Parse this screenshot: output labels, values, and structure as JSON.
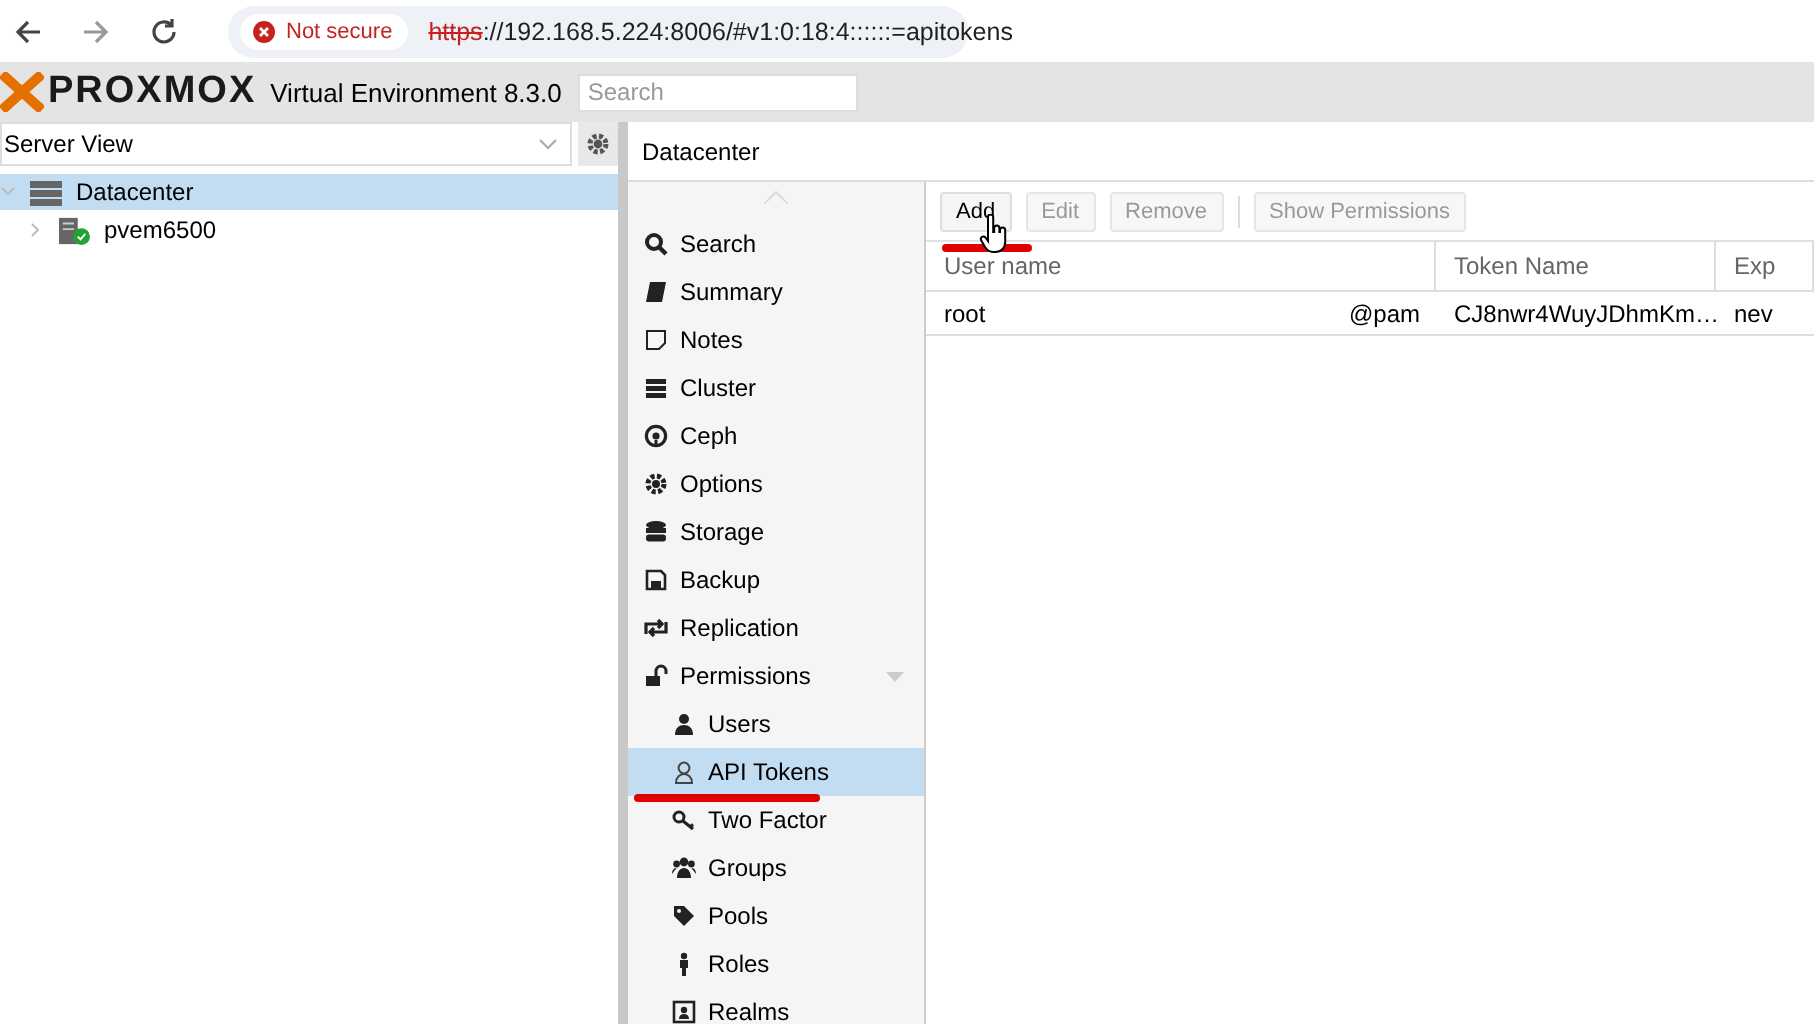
{
  "browser": {
    "security": "Not secure",
    "url_scheme": "https",
    "url_rest": "://192.168.5.224:8006/#v1:0:18:4::::::=apitokens"
  },
  "header": {
    "logo": "PROXMOX",
    "product": "Virtual Environment 8.3.0",
    "search": {
      "placeholder": "Search"
    }
  },
  "sidebar": {
    "view": "Server View",
    "tree": [
      {
        "label": "Datacenter",
        "selected": true,
        "expanded": true,
        "children": [
          {
            "label": "pvem6500",
            "selected": false,
            "expanded": false
          }
        ]
      }
    ]
  },
  "panel": {
    "title": "Datacenter",
    "nav": [
      {
        "label": "Search",
        "selected": false
      },
      {
        "label": "Summary",
        "selected": false
      },
      {
        "label": "Notes",
        "selected": false
      },
      {
        "label": "Cluster",
        "selected": false
      },
      {
        "label": "Ceph",
        "selected": false
      },
      {
        "label": "Options",
        "selected": false
      },
      {
        "label": "Storage",
        "selected": false
      },
      {
        "label": "Backup",
        "selected": false
      },
      {
        "label": "Replication",
        "selected": false
      },
      {
        "label": "Permissions",
        "selected": false,
        "expanded": true,
        "children": [
          {
            "label": "Users",
            "selected": false
          },
          {
            "label": "API Tokens",
            "selected": true
          },
          {
            "label": "Two Factor",
            "selected": false
          },
          {
            "label": "Groups",
            "selected": false
          },
          {
            "label": "Pools",
            "selected": false
          },
          {
            "label": "Roles",
            "selected": false
          },
          {
            "label": "Realms",
            "selected": false
          }
        ]
      }
    ],
    "toolbar": [
      {
        "label": "Add",
        "disabled": false
      },
      {
        "label": "Edit",
        "disabled": true
      },
      {
        "label": "Remove",
        "disabled": true
      },
      {
        "label": "Show Permissions",
        "disabled": true
      }
    ],
    "table": {
      "columns": [
        "User name",
        "Token Name",
        "Exp"
      ],
      "rows": [
        {
          "user": "root",
          "realm": "@pam",
          "token": "CJ8nwr4WuyJDhmKm…",
          "column_3": "nev",
          "selected": false
        }
      ]
    }
  }
}
